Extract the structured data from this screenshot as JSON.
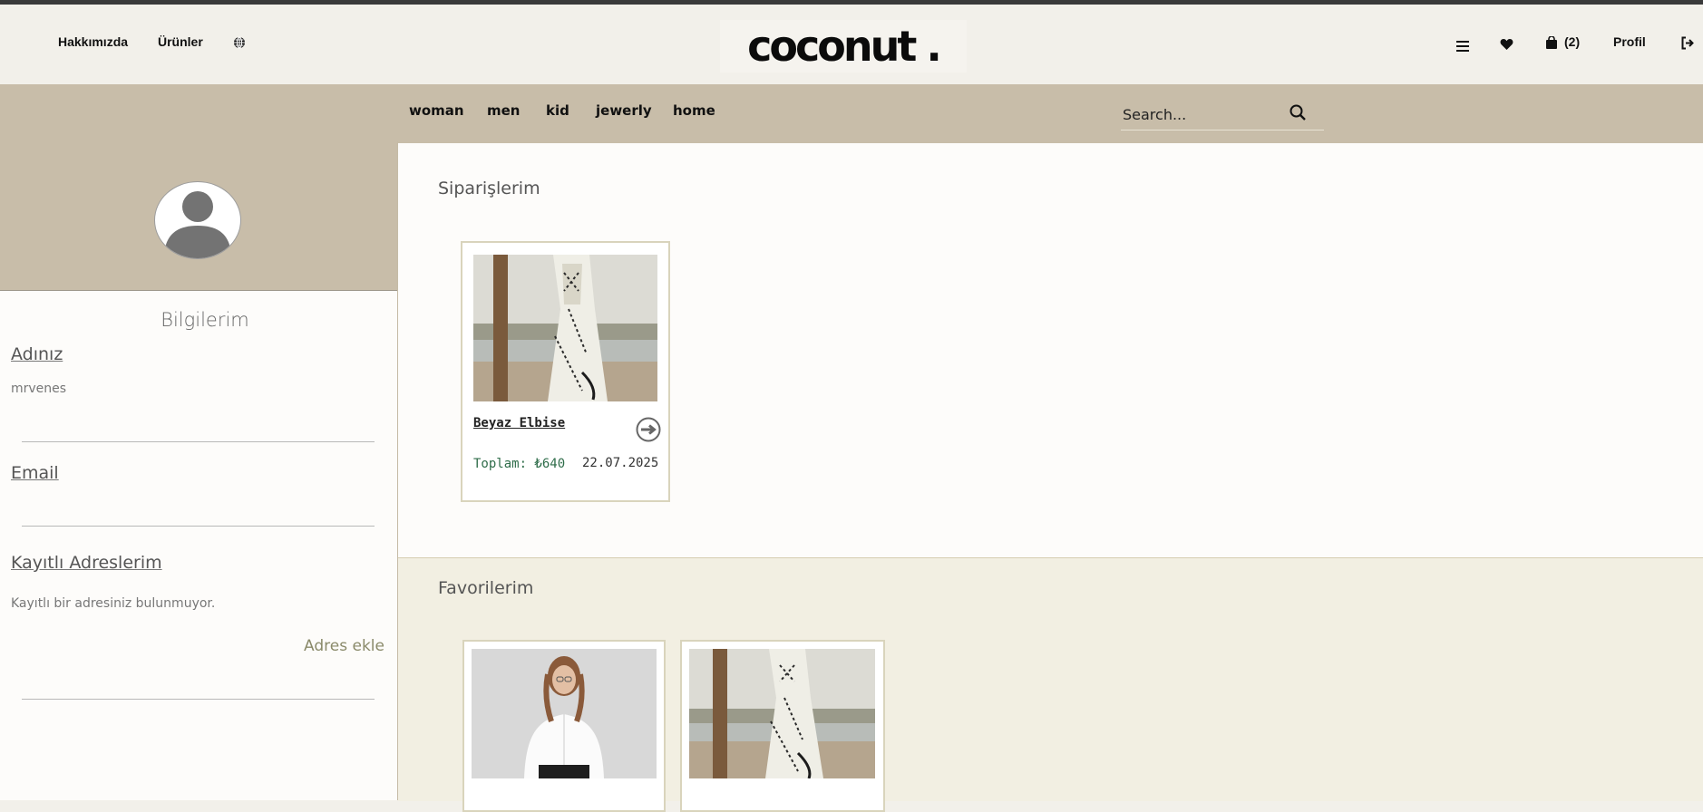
{
  "header": {
    "about_label": "Hakkımızda",
    "products_label": "Ürünler",
    "logo_text": "coconut .",
    "cart_count": "(2)",
    "profile_label": "Profil",
    "icons": [
      "globe-icon",
      "menu-icon",
      "heart-icon",
      "cart-icon",
      "logout-icon"
    ]
  },
  "nav": {
    "items": [
      "woman",
      "men",
      "kid",
      "jewerly",
      "home"
    ],
    "search_placeholder": "Search..."
  },
  "sidebar": {
    "title": "Bilgilerim",
    "name_label": "Adınız",
    "name_value": "mrvenes",
    "email_label": "Email",
    "email_value": "",
    "address_label": "Kayıtlı Adreslerim",
    "address_empty": "Kayıtlı bir adresiniz bulunmuyor.",
    "add_address": "Adres ekle"
  },
  "orders": {
    "title": "Siparişlerim",
    "items": [
      {
        "name": "Beyaz Elbise",
        "total": "Toplam: ₺640",
        "date": "22.07.2025"
      }
    ]
  },
  "favorites": {
    "title": "Favorilerim"
  },
  "colors": {
    "accent_band": "#c8bda9",
    "header_bg": "#f2f0ea",
    "total_green": "#2f6d4a",
    "favorites_bg": "#f2efe2"
  }
}
